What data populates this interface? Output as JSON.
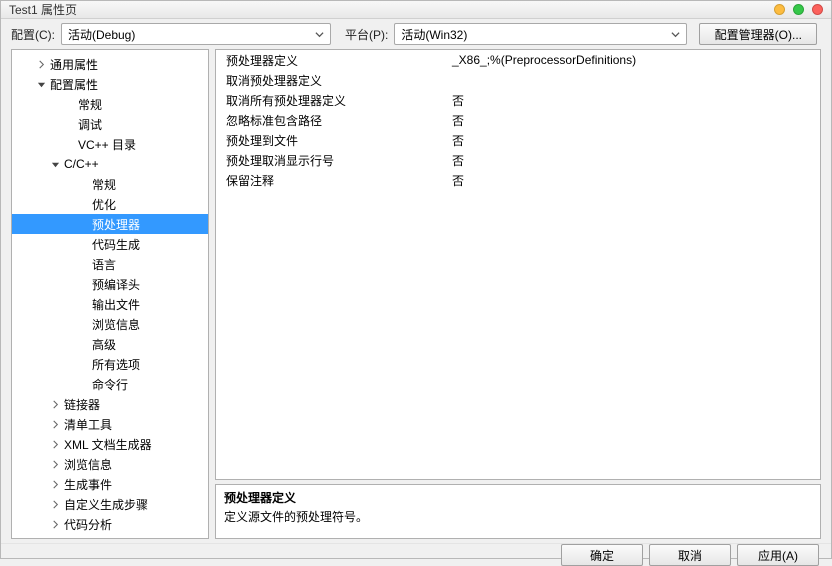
{
  "window": {
    "title": "Test1 属性页"
  },
  "toolbar": {
    "config_label": "配置(C):",
    "config_value": "活动(Debug)",
    "platform_label": "平台(P):",
    "platform_value": "活动(Win32)",
    "manager_button": "配置管理器(O)..."
  },
  "tree": [
    {
      "label": "通用属性",
      "indent": 16,
      "expander": "right"
    },
    {
      "label": "配置属性",
      "indent": 16,
      "expander": "down"
    },
    {
      "label": "常规",
      "indent": 44,
      "expander": ""
    },
    {
      "label": "调试",
      "indent": 44,
      "expander": ""
    },
    {
      "label": "VC++ 目录",
      "indent": 44,
      "expander": ""
    },
    {
      "label": "C/C++",
      "indent": 30,
      "expander": "down"
    },
    {
      "label": "常规",
      "indent": 58,
      "expander": ""
    },
    {
      "label": "优化",
      "indent": 58,
      "expander": ""
    },
    {
      "label": "预处理器",
      "indent": 58,
      "expander": "",
      "selected": true
    },
    {
      "label": "代码生成",
      "indent": 58,
      "expander": ""
    },
    {
      "label": "语言",
      "indent": 58,
      "expander": ""
    },
    {
      "label": "预编译头",
      "indent": 58,
      "expander": ""
    },
    {
      "label": "输出文件",
      "indent": 58,
      "expander": ""
    },
    {
      "label": "浏览信息",
      "indent": 58,
      "expander": ""
    },
    {
      "label": "高级",
      "indent": 58,
      "expander": ""
    },
    {
      "label": "所有选项",
      "indent": 58,
      "expander": ""
    },
    {
      "label": "命令行",
      "indent": 58,
      "expander": ""
    },
    {
      "label": "链接器",
      "indent": 30,
      "expander": "right"
    },
    {
      "label": "清单工具",
      "indent": 30,
      "expander": "right"
    },
    {
      "label": "XML 文档生成器",
      "indent": 30,
      "expander": "right"
    },
    {
      "label": "浏览信息",
      "indent": 30,
      "expander": "right"
    },
    {
      "label": "生成事件",
      "indent": 30,
      "expander": "right"
    },
    {
      "label": "自定义生成步骤",
      "indent": 30,
      "expander": "right"
    },
    {
      "label": "代码分析",
      "indent": 30,
      "expander": "right"
    }
  ],
  "properties": [
    {
      "name": "预处理器定义",
      "value": "_X86_;%(PreprocessorDefinitions)"
    },
    {
      "name": "取消预处理器定义",
      "value": ""
    },
    {
      "name": "取消所有预处理器定义",
      "value": "否"
    },
    {
      "name": "忽略标准包含路径",
      "value": "否"
    },
    {
      "name": "预处理到文件",
      "value": "否"
    },
    {
      "name": "预处理取消显示行号",
      "value": "否"
    },
    {
      "name": "保留注释",
      "value": "否"
    }
  ],
  "description": {
    "title": "预处理器定义",
    "text": "定义源文件的预处理符号。"
  },
  "footer": {
    "ok": "确定",
    "cancel": "取消",
    "apply": "应用(A)"
  }
}
